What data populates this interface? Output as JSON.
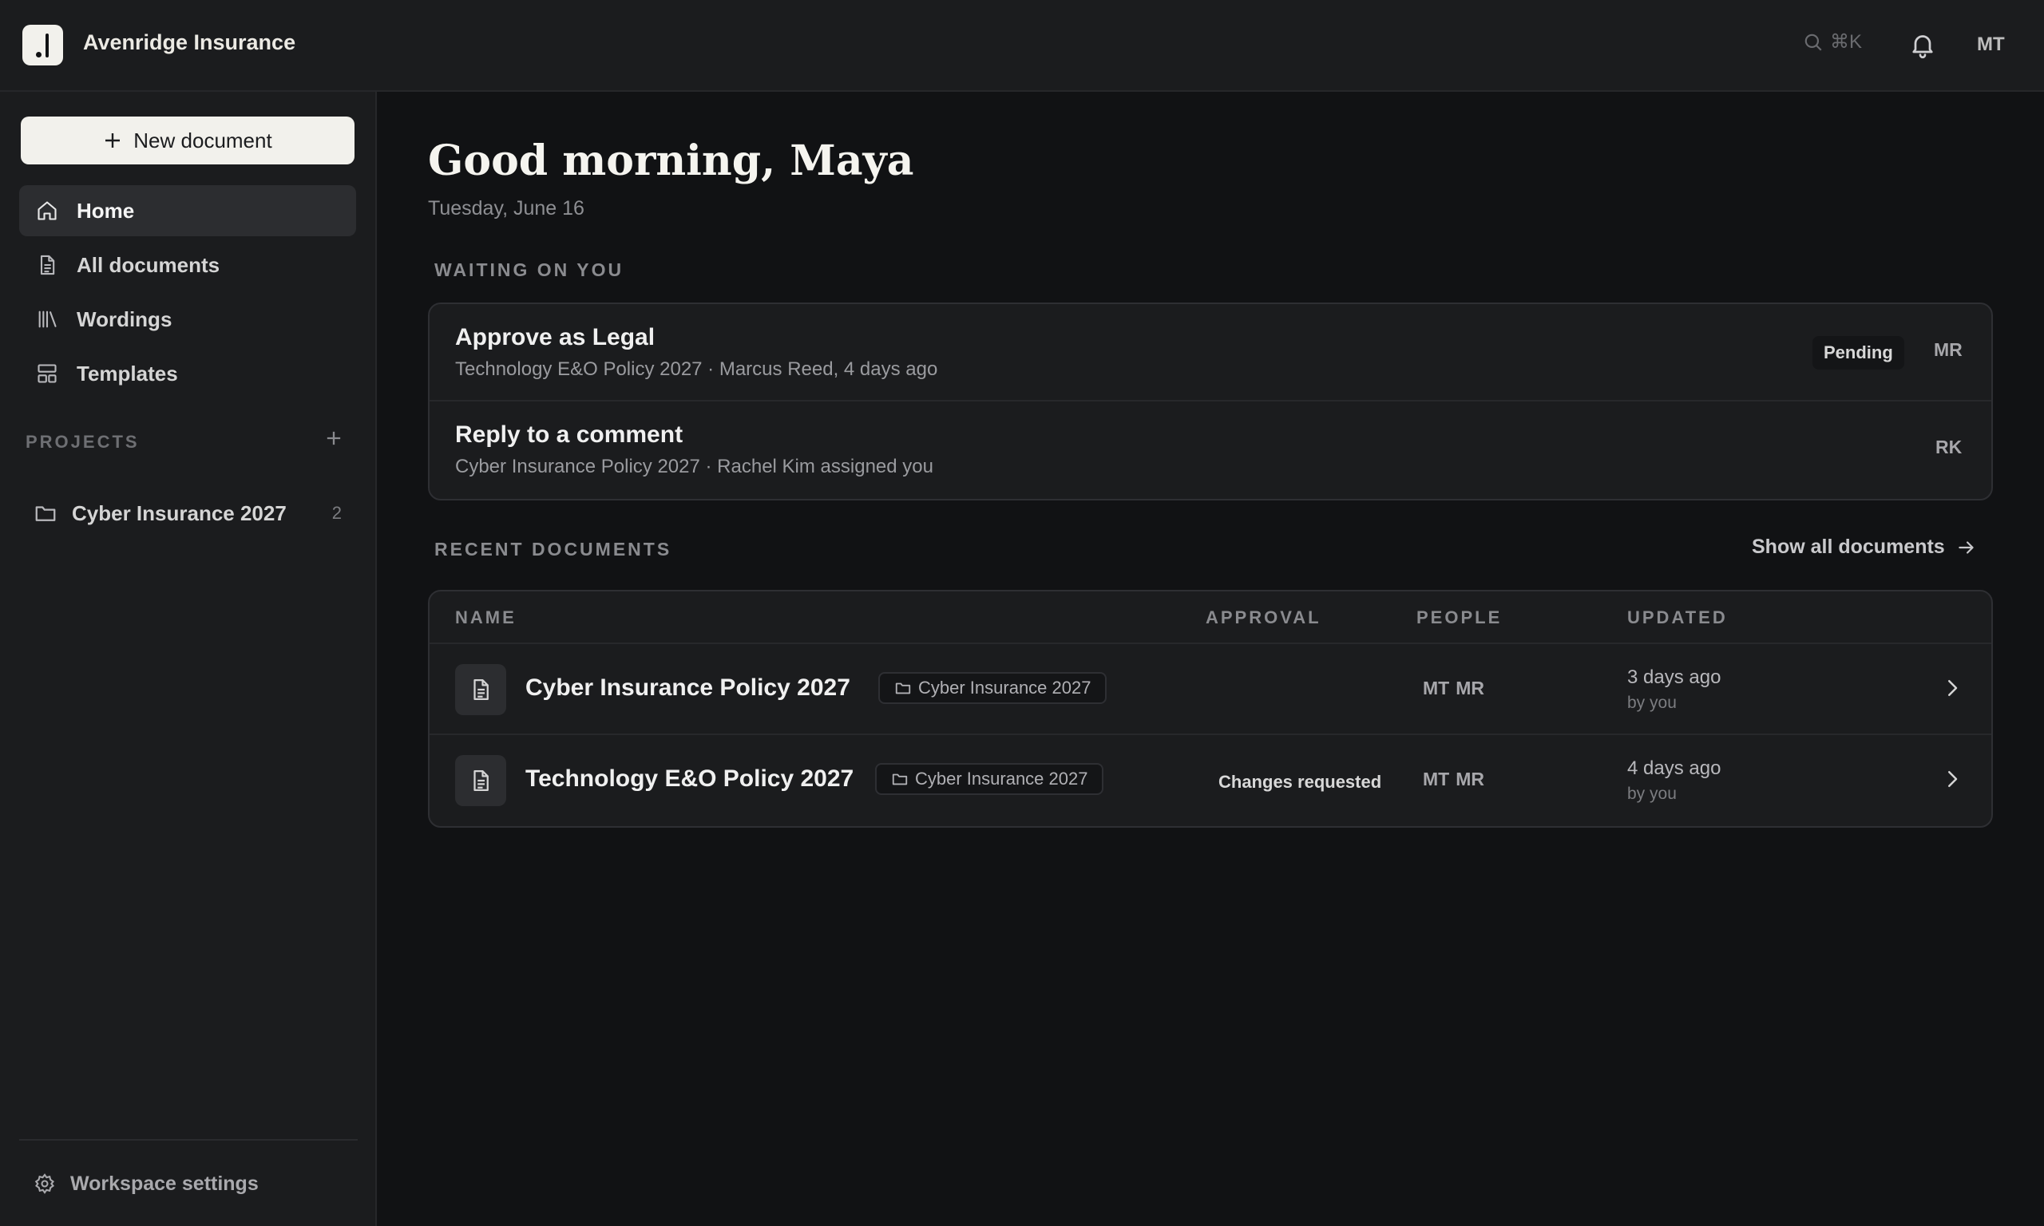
{
  "header": {
    "brand": "Avenridge Insurance",
    "search_shortcut": "⌘K",
    "user_initials": "MT"
  },
  "sidebar": {
    "new_document_label": "New document",
    "nav": [
      {
        "label": "Home",
        "icon": "home-icon",
        "active": true
      },
      {
        "label": "All documents",
        "icon": "document-icon"
      },
      {
        "label": "Wordings",
        "icon": "library-icon"
      },
      {
        "label": "Templates",
        "icon": "templates-icon"
      }
    ],
    "projects_label": "PROJECTS",
    "projects": [
      {
        "name": "Cyber Insurance 2027",
        "count": "2"
      }
    ],
    "settings_label": "Workspace settings"
  },
  "main": {
    "greeting": "Good morning, Maya",
    "date": "Tuesday, June 16",
    "waiting_label": "WAITING ON YOU",
    "tasks": [
      {
        "title": "Approve as Legal",
        "subtitle": "Technology E&O Policy 2027 · Marcus Reed, 4 days ago",
        "badge": "Pending",
        "avatar": "MR"
      },
      {
        "title": "Reply to a comment",
        "subtitle": "Cyber Insurance Policy 2027 · Rachel Kim assigned you",
        "badge": "",
        "avatar": "RK"
      }
    ],
    "recent_label": "RECENT DOCUMENTS",
    "show_all_label": "Show all documents",
    "table": {
      "headers": {
        "name": "NAME",
        "approval": "APPROVAL",
        "people": "PEOPLE",
        "updated": "UPDATED"
      },
      "rows": [
        {
          "name": "Cyber Insurance Policy 2027",
          "tag": "Cyber Insurance 2027",
          "approval": "",
          "people": [
            "MT",
            "MR"
          ],
          "updated": "3 days ago",
          "by": "by you"
        },
        {
          "name": "Technology E&O Policy 2027",
          "tag": "Cyber Insurance 2027",
          "approval": "Changes requested",
          "people": [
            "MT",
            "MR"
          ],
          "updated": "4 days ago",
          "by": "by you"
        }
      ]
    }
  }
}
